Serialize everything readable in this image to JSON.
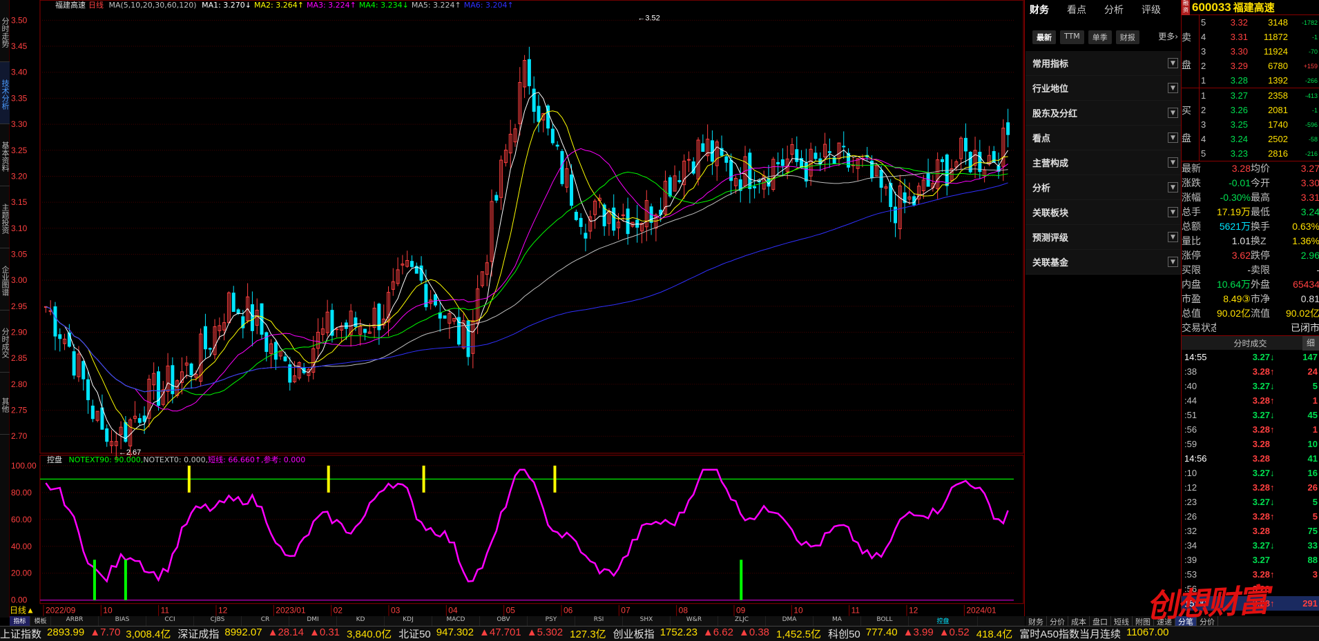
{
  "left_tabs": [
    "分时走势",
    "技术分析",
    "基本资料",
    "主题投资",
    "企业图谱",
    "分时成交",
    "其他"
  ],
  "legend": {
    "title": "福建高速",
    "period": "日线",
    "ma_def": "MA(5,10,20,30,60,120)",
    "items": [
      {
        "label": "MA1: 3.270↓",
        "color": "#ffffff"
      },
      {
        "label": "MA2: 3.264↑",
        "color": "#ffff00"
      },
      {
        "label": "MA3: 3.224↑",
        "color": "#ff00ff"
      },
      {
        "label": "MA4: 3.234↓",
        "color": "#00ff00"
      },
      {
        "label": "MA5: 3.224↑",
        "color": "#c0c0c0"
      },
      {
        "label": "MA6: 3.204↑",
        "color": "#3030ff"
      }
    ]
  },
  "price_axis": [
    "3.50",
    "3.45",
    "3.40",
    "3.35",
    "3.30",
    "3.25",
    "3.20",
    "3.15",
    "3.10",
    "3.05",
    "3.00",
    "2.95",
    "2.90",
    "2.85",
    "2.80",
    "2.75",
    "2.70"
  ],
  "annotations": {
    "high": "3.52",
    "low": "2.67"
  },
  "indicator": {
    "name": "控盘",
    "items": [
      {
        "label": "NOTEXT90: 90.000,",
        "color": "#00ff00"
      },
      {
        "label": "NOTEXT0: 0.000,",
        "color": "#c0c0c0"
      },
      {
        "label": "短线: 66.660↑,",
        "color": "#ff00ff"
      },
      {
        "label": "参考: 0.000",
        "color": "#ff00ff"
      }
    ],
    "axis": [
      "100.00",
      "80.00",
      "60.00",
      "40.00",
      "20.00",
      "0.00"
    ]
  },
  "date_axis": {
    "period_button": "日线▲",
    "labels": [
      "2022/09",
      "10",
      "11",
      "12",
      "2023/01",
      "02",
      "03",
      "04",
      "05",
      "06",
      "07",
      "08",
      "09",
      "10",
      "11",
      "12",
      "2024/01"
    ]
  },
  "bottom_tabs": [
    "指标",
    "模板",
    "ARBR",
    "BIAS",
    "CCI",
    "CJBS",
    "CR",
    "DMI",
    "KD",
    "KDJ",
    "MACD",
    "OBV",
    "PSY",
    "RSI",
    "SHX",
    "W&R",
    "ZLJC",
    "DMA",
    "MA",
    "BOLL",
    "控盘"
  ],
  "fin": {
    "tabs": [
      "财务",
      "看点",
      "分析",
      "评级"
    ],
    "subtabs": [
      "最新",
      "TTM",
      "单季",
      "财报"
    ],
    "more": "更多›",
    "sections": [
      "常用指标",
      "行业地位",
      "股东及分红",
      "看点",
      "主营构成",
      "分析",
      "关联板块",
      "预测评级",
      "关联基金"
    ]
  },
  "quote": {
    "rz": "融资",
    "code": "600033",
    "name": "福建高速",
    "sell_label": "卖盘",
    "buy_label": "买盘",
    "sell": [
      {
        "lv": "5",
        "price": "3.32",
        "vol": "3148",
        "chg": "-1782"
      },
      {
        "lv": "4",
        "price": "3.31",
        "vol": "11872",
        "chg": "-1"
      },
      {
        "lv": "3",
        "price": "3.30",
        "vol": "11924",
        "chg": "-70"
      },
      {
        "lv": "2",
        "price": "3.29",
        "vol": "6780",
        "chg": "+159"
      },
      {
        "lv": "1",
        "price": "3.28",
        "vol": "1392",
        "chg": "-266"
      }
    ],
    "buy": [
      {
        "lv": "1",
        "price": "3.27",
        "vol": "2358",
        "chg": "-413"
      },
      {
        "lv": "2",
        "price": "3.26",
        "vol": "2081",
        "chg": "-1"
      },
      {
        "lv": "3",
        "price": "3.25",
        "vol": "1740",
        "chg": "-596"
      },
      {
        "lv": "4",
        "price": "3.24",
        "vol": "2502",
        "chg": "-58"
      },
      {
        "lv": "5",
        "price": "3.23",
        "vol": "2816",
        "chg": "-216"
      }
    ],
    "stats": [
      {
        "k": "最新",
        "v": "3.28",
        "c": "#ff4040",
        "k2": "均价",
        "v2": "3.27",
        "c2": "#ff4040"
      },
      {
        "k": "涨跌",
        "v": "-0.01",
        "c": "#00e050",
        "k2": "今开",
        "v2": "3.30",
        "c2": "#ff4040"
      },
      {
        "k": "涨幅",
        "v": "-0.30%",
        "c": "#00e050",
        "k2": "最高",
        "v2": "3.31",
        "c2": "#ff4040"
      },
      {
        "k": "总手",
        "v": "17.19万",
        "c": "#ffe000",
        "k2": "最低",
        "v2": "3.24",
        "c2": "#00e050"
      },
      {
        "k": "总额",
        "v": "5621万",
        "c": "#00e5ff",
        "k2": "换手",
        "v2": "0.63%",
        "c2": "#ffe000"
      },
      {
        "k": "量比",
        "v": "1.01",
        "c": "#e0e0e0",
        "k2": "换Z",
        "v2": "1.36%",
        "c2": "#ffe000"
      },
      {
        "k": "涨停",
        "v": "3.62",
        "c": "#ff4040",
        "k2": "跌停",
        "v2": "2.96",
        "c2": "#00e050"
      },
      {
        "k": "买限",
        "v": "-",
        "c": "#e0e0e0",
        "k2": "卖限",
        "v2": "-",
        "c2": "#e0e0e0"
      },
      {
        "k": "内盘",
        "v": "10.64万",
        "c": "#00e050",
        "k2": "外盘",
        "v2": "65434",
        "c2": "#ff4040"
      },
      {
        "k": "市盈",
        "v": "8.49③",
        "c": "#ffe000",
        "k2": "市净",
        "v2": "0.81",
        "c2": "#e0e0e0"
      },
      {
        "k": "总值",
        "v": "90.02亿",
        "c": "#ffe000",
        "k2": "流值",
        "v2": "90.02亿",
        "c2": "#ffe000"
      },
      {
        "k": "交易状态",
        "v": "",
        "c": "#e0e0e0",
        "k2": "",
        "v2": "已闭市",
        "c2": "#e0e0e0"
      }
    ],
    "ticks_title": "分时成交",
    "ticks_detail": "细",
    "ticks": [
      {
        "t": "14:55",
        "p": "3.27",
        "a": "↓",
        "q": "147",
        "c": "#00e050",
        "hd": true
      },
      {
        "t": ":38",
        "p": "3.28",
        "a": "↑",
        "q": "24",
        "c": "#ff4040"
      },
      {
        "t": ":40",
        "p": "3.27",
        "a": "↓",
        "q": "5",
        "c": "#00e050"
      },
      {
        "t": ":44",
        "p": "3.28",
        "a": "↑",
        "q": "1",
        "c": "#ff4040"
      },
      {
        "t": ":51",
        "p": "3.27",
        "a": "↓",
        "q": "45",
        "c": "#00e050"
      },
      {
        "t": ":56",
        "p": "3.28",
        "a": "↑",
        "q": "1",
        "c": "#ff4040"
      },
      {
        "t": ":59",
        "p": "3.28",
        "a": "",
        "q": "10",
        "c": "#00e050"
      },
      {
        "t": "14:56",
        "p": "3.28",
        "a": "",
        "q": "41",
        "c": "#00e050",
        "hd": true
      },
      {
        "t": ":10",
        "p": "3.27",
        "a": "↓",
        "q": "16",
        "c": "#00e050"
      },
      {
        "t": ":12",
        "p": "3.28",
        "a": "↑",
        "q": "26",
        "c": "#ff4040"
      },
      {
        "t": ":23",
        "p": "3.27",
        "a": "↓",
        "q": "5",
        "c": "#00e050"
      },
      {
        "t": ":26",
        "p": "3.28",
        "a": "↑",
        "q": "5",
        "c": "#ff4040"
      },
      {
        "t": ":32",
        "p": "3.28",
        "a": "",
        "q": "75",
        "c": "#00e050"
      },
      {
        "t": ":34",
        "p": "3.27",
        "a": "↓",
        "q": "33",
        "c": "#00e050"
      },
      {
        "t": ":39",
        "p": "3.27",
        "a": "",
        "q": "88",
        "c": "#00e050"
      },
      {
        "t": ":53",
        "p": "3.28",
        "a": "↑",
        "q": "3",
        "c": "#ff4040"
      },
      {
        "t": ":56",
        "p": "3.28",
        "a": "",
        "q": "",
        "c": "#00e050"
      },
      {
        "t": "15:00",
        "p": "3.28",
        "a": "↑",
        "q": "291",
        "c": "#ff4040",
        "hd": true
      }
    ],
    "bottom_tabs": [
      "财务",
      "分价",
      "成本",
      "盘口",
      "短线",
      "附图",
      "速递",
      "分笔",
      "分价"
    ]
  },
  "status": [
    {
      "nm": "上证指数",
      "val": "2893.99",
      "chg": "▲7.70",
      "amt": "3,008.4亿"
    },
    {
      "nm": "深证成指",
      "val": "8992.07",
      "chg": "▲28.14",
      "amt": "▲0.31"
    },
    {
      "nm": "",
      "val": "3,840.0亿",
      "chg": "",
      "amt": ""
    },
    {
      "nm": "北证50",
      "val": "947.302",
      "chg": "▲47.701",
      "amt": "▲5.302"
    },
    {
      "nm": "",
      "val": "127.3亿",
      "chg": "",
      "amt": ""
    },
    {
      "nm": "创业板指",
      "val": "1752.23",
      "chg": "▲6.62",
      "amt": "▲0.38"
    },
    {
      "nm": "",
      "val": "1,452.5亿",
      "chg": "",
      "amt": ""
    },
    {
      "nm": "科创50",
      "val": "777.40",
      "chg": "▲3.99",
      "amt": "▲0.52"
    },
    {
      "nm": "",
      "val": "418.4亿",
      "chg": "",
      "amt": ""
    },
    {
      "nm": "富时A50指数当月连续",
      "val": "11067.00",
      "chg": "",
      "amt": ""
    }
  ],
  "watermark": "创想财富",
  "colors": {
    "up": "#ff4040",
    "down": "#00e5ff",
    "grid": "#8b0000",
    "ma1": "#ffffff",
    "ma2": "#ffff00",
    "ma3": "#ff00ff",
    "ma4": "#00ff00",
    "ma5": "#c0c0c0",
    "ma6": "#3030ff",
    "kp": "#ff00ff"
  },
  "chart_data": {
    "type": "line",
    "title": "福建高速 日线",
    "ylim": [
      2.67,
      3.52
    ],
    "y_ticks": [
      2.7,
      2.75,
      2.8,
      2.85,
      2.9,
      2.95,
      3.0,
      3.05,
      3.1,
      3.15,
      3.2,
      3.25,
      3.3,
      3.35,
      3.4,
      3.45,
      3.5
    ],
    "x_labels": [
      "2022/09",
      "10",
      "11",
      "12",
      "2023/01",
      "02",
      "03",
      "04",
      "05",
      "06",
      "07",
      "08",
      "09",
      "10",
      "11",
      "12",
      "2024/01"
    ],
    "close_by_month_approx": [
      2.95,
      2.7,
      2.78,
      2.95,
      2.85,
      2.9,
      3.0,
      2.9,
      3.4,
      3.1,
      3.15,
      3.25,
      3.2,
      3.25,
      3.15,
      3.2,
      3.28
    ],
    "series": [
      {
        "name": "MA1",
        "last": 3.27
      },
      {
        "name": "MA2",
        "last": 3.264
      },
      {
        "name": "MA3",
        "last": 3.224
      },
      {
        "name": "MA4",
        "last": 3.234
      },
      {
        "name": "MA5",
        "last": 3.224
      },
      {
        "name": "MA6",
        "last": 3.204
      }
    ],
    "high": 3.52,
    "low": 2.67,
    "indicator": {
      "name": "控盘",
      "ylim": [
        0,
        100
      ],
      "y_ticks": [
        0,
        20,
        40,
        60,
        80,
        100
      ],
      "NOTEXT90": 90,
      "NOTEXT0": 0,
      "短线_last": 66.66,
      "参考_last": 0,
      "短线_by_month_approx": [
        85,
        20,
        30,
        85,
        40,
        60,
        85,
        15,
        95,
        20,
        45,
        95,
        60,
        45,
        40,
        85,
        66.66
      ]
    }
  }
}
